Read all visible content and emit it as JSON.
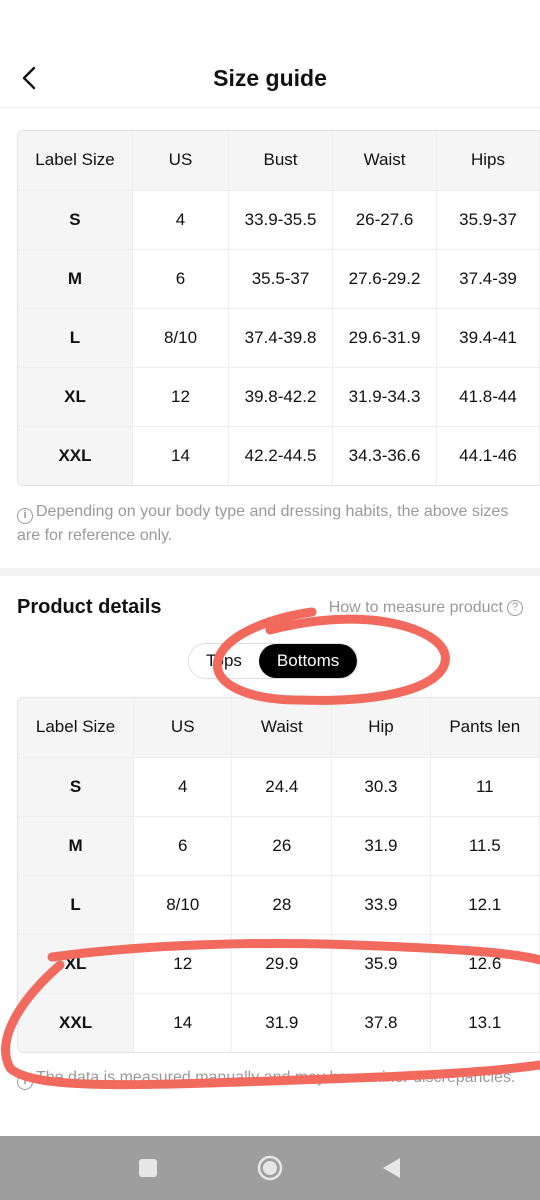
{
  "header": {
    "title": "Size guide",
    "back_icon": "chevron-left-icon"
  },
  "body_table": {
    "columns": [
      "Label Size",
      "US",
      "Bust",
      "Waist",
      "Hips"
    ],
    "rows": [
      [
        "S",
        "4",
        "33.9-35.5",
        "26-27.6",
        "35.9-37"
      ],
      [
        "M",
        "6",
        "35.5-37",
        "27.6-29.2",
        "37.4-39"
      ],
      [
        "L",
        "8/10",
        "37.4-39.8",
        "29.6-31.9",
        "39.4-41"
      ],
      [
        "XL",
        "12",
        "39.8-42.2",
        "31.9-34.3",
        "41.8-44"
      ],
      [
        "XXL",
        "14",
        "42.2-44.5",
        "34.3-36.6",
        "44.1-46"
      ]
    ],
    "note": "Depending on your body type and dressing habits, the above sizes are for reference only."
  },
  "product_details": {
    "title": "Product details",
    "measure_link": "How to measure product",
    "tabs": [
      {
        "label": "Tops",
        "selected": false
      },
      {
        "label": "Bottoms",
        "selected": true
      }
    ],
    "columns": [
      "Label Size",
      "US",
      "Waist",
      "Hip",
      "Pants len"
    ],
    "rows": [
      [
        "S",
        "4",
        "24.4",
        "30.3",
        "11"
      ],
      [
        "M",
        "6",
        "26",
        "31.9",
        "11.5"
      ],
      [
        "L",
        "8/10",
        "28",
        "33.9",
        "12.1"
      ],
      [
        "XL",
        "12",
        "29.9",
        "35.9",
        "12.6"
      ],
      [
        "XXL",
        "14",
        "31.9",
        "37.8",
        "13.1"
      ]
    ],
    "note": "The data is measured manually and may have minor discrepancies."
  },
  "navbar": {
    "icons": [
      "recent-apps-icon",
      "home-icon",
      "back-triangle-icon"
    ]
  },
  "colors": {
    "annotation": "#f26a5e",
    "navbar": "#9e9e9e",
    "selected_tab": "#000000"
  }
}
